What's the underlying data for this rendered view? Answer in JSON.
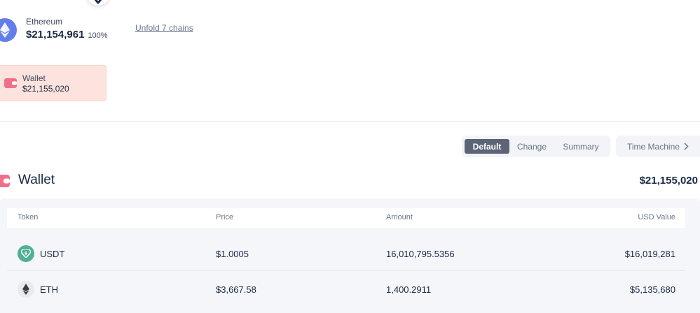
{
  "chain": {
    "name": "Ethereum",
    "value": "$21,154,961",
    "percent": "100%",
    "unfold_label": "Unfold 7 chains",
    "color": "#627EEA"
  },
  "wallet_card": {
    "label": "Wallet",
    "value": "$21,155,020",
    "bg_color": "#fde3dd",
    "icon": "wallet-icon"
  },
  "view_tabs": {
    "default_label": "Default",
    "change_label": "Change",
    "summary_label": "Summary",
    "active": "Default"
  },
  "time_machine_label": "Time Machine",
  "section": {
    "title": "Wallet",
    "total": "$21,155,020"
  },
  "table": {
    "columns": [
      "Token",
      "Price",
      "Amount",
      "USD Value"
    ],
    "rows": [
      {
        "token": "USDT",
        "icon": "usdt-icon",
        "price": "$1.0005",
        "amount": "16,010,795.5356",
        "usd_value": "$16,019,281"
      },
      {
        "token": "ETH",
        "icon": "eth-icon",
        "price": "$3,667.58",
        "amount": "1,400.2911",
        "usd_value": "$5,135,680"
      }
    ]
  },
  "colors": {
    "accent_dark": "#5c6476",
    "wallet_pink": "#f0708a",
    "usdt_green": "#50AF95",
    "eth_blue": "#627EEA"
  }
}
